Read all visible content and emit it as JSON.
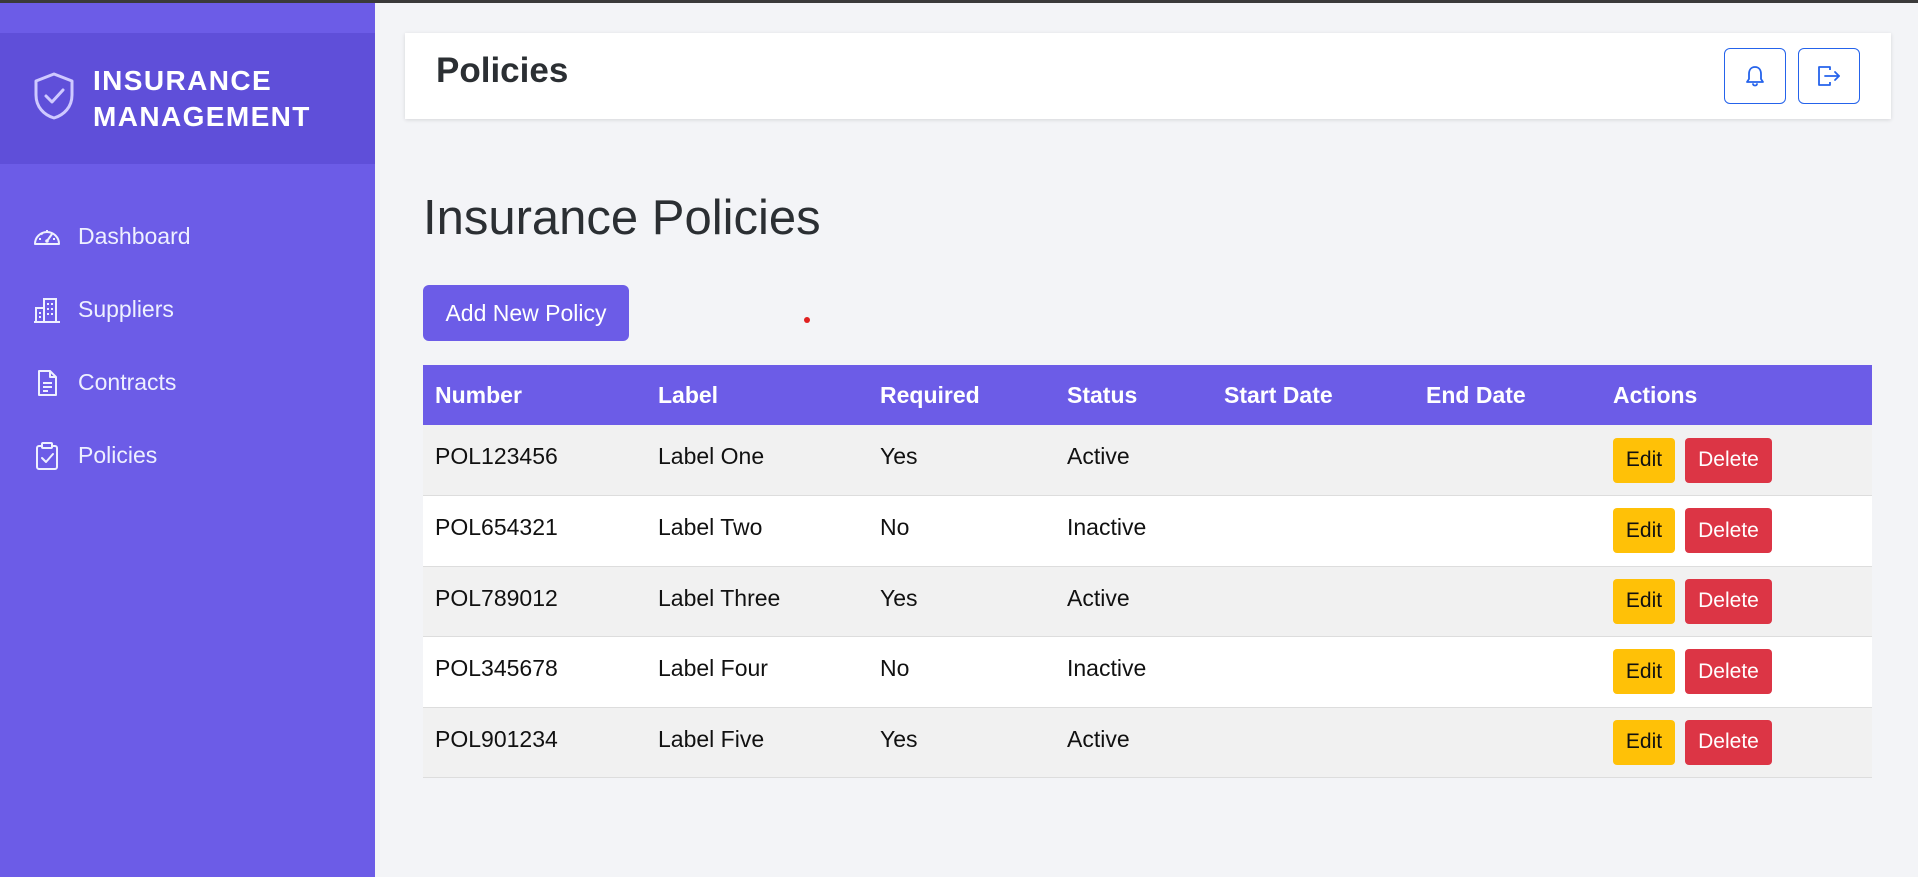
{
  "brand": {
    "line1": "INSURANCE",
    "line2": "MANAGEMENT",
    "icon": "shield-check-icon"
  },
  "sidebar": {
    "items": [
      {
        "label": "Dashboard",
        "icon": "speedometer-icon"
      },
      {
        "label": "Suppliers",
        "icon": "building-icon"
      },
      {
        "label": "Contracts",
        "icon": "document-icon"
      },
      {
        "label": "Policies",
        "icon": "clipboard-check-icon"
      }
    ]
  },
  "header": {
    "title": "Policies",
    "bell_icon": "bell-icon",
    "logout_icon": "logout-icon"
  },
  "main": {
    "heading": "Insurance Policies",
    "add_button": "Add New Policy"
  },
  "table": {
    "headers": [
      "Number",
      "Label",
      "Required",
      "Status",
      "Start Date",
      "End Date",
      "Actions"
    ],
    "rows": [
      {
        "number": "POL123456",
        "label": "Label One",
        "required": "Yes",
        "status": "Active",
        "start": "",
        "end": ""
      },
      {
        "number": "POL654321",
        "label": "Label Two",
        "required": "No",
        "status": "Inactive",
        "start": "",
        "end": ""
      },
      {
        "number": "POL789012",
        "label": "Label Three",
        "required": "Yes",
        "status": "Active",
        "start": "",
        "end": ""
      },
      {
        "number": "POL345678",
        "label": "Label Four",
        "required": "No",
        "status": "Inactive",
        "start": "",
        "end": ""
      },
      {
        "number": "POL901234",
        "label": "Label Five",
        "required": "Yes",
        "status": "Active",
        "start": "",
        "end": ""
      }
    ],
    "edit_label": "Edit",
    "delete_label": "Delete"
  },
  "colors": {
    "primary": "#6c5ce7",
    "brand_bg": "#5f4fd9",
    "edit": "#ffc107",
    "delete": "#dc3545",
    "outline": "#2563eb"
  }
}
